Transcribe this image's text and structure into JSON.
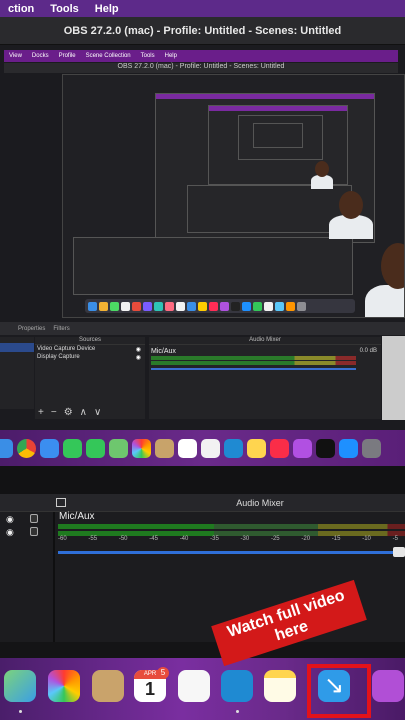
{
  "mac_menu": {
    "items": [
      "ction",
      "Tools",
      "Help"
    ]
  },
  "window_title": "OBS 27.2.0 (mac) - Profile: Untitled - Scenes: Untitled",
  "inner_menu": {
    "items": [
      "View",
      "Docks",
      "Profile",
      "Scene Collection",
      "Tools",
      "Help"
    ]
  },
  "inner_title": "OBS 27.2.0 (mac) - Profile: Untitled - Scenes: Untitled",
  "panel_tabs": {
    "properties": "Properties",
    "filters": "Filters"
  },
  "sources": {
    "header": "Sources",
    "items": [
      "Video Capture Device",
      "Display Capture"
    ]
  },
  "source_toolbar": {
    "add": "+",
    "remove": "−",
    "settings": "⚙",
    "up": "∧",
    "down": "∨"
  },
  "small_mixer": {
    "header": "Audio Mixer",
    "channel": "Mic/Aux",
    "db": "0.0 dB"
  },
  "large_mixer": {
    "header": "Audio Mixer",
    "channel": "Mic/Aux",
    "ticks": [
      "-60",
      "-55",
      "-50",
      "-45",
      "-40",
      "-35",
      "-30",
      "-25",
      "-20",
      "-15",
      "-10",
      "-5"
    ]
  },
  "calendar": {
    "month": "APR",
    "day": "1",
    "badge": "5"
  },
  "cta": {
    "line1": "Watch full video",
    "line2": "here"
  },
  "colors": {
    "accent_purple": "#6a2a8a",
    "cta_red": "#d31919",
    "volume_blue": "#2f6fd8"
  }
}
